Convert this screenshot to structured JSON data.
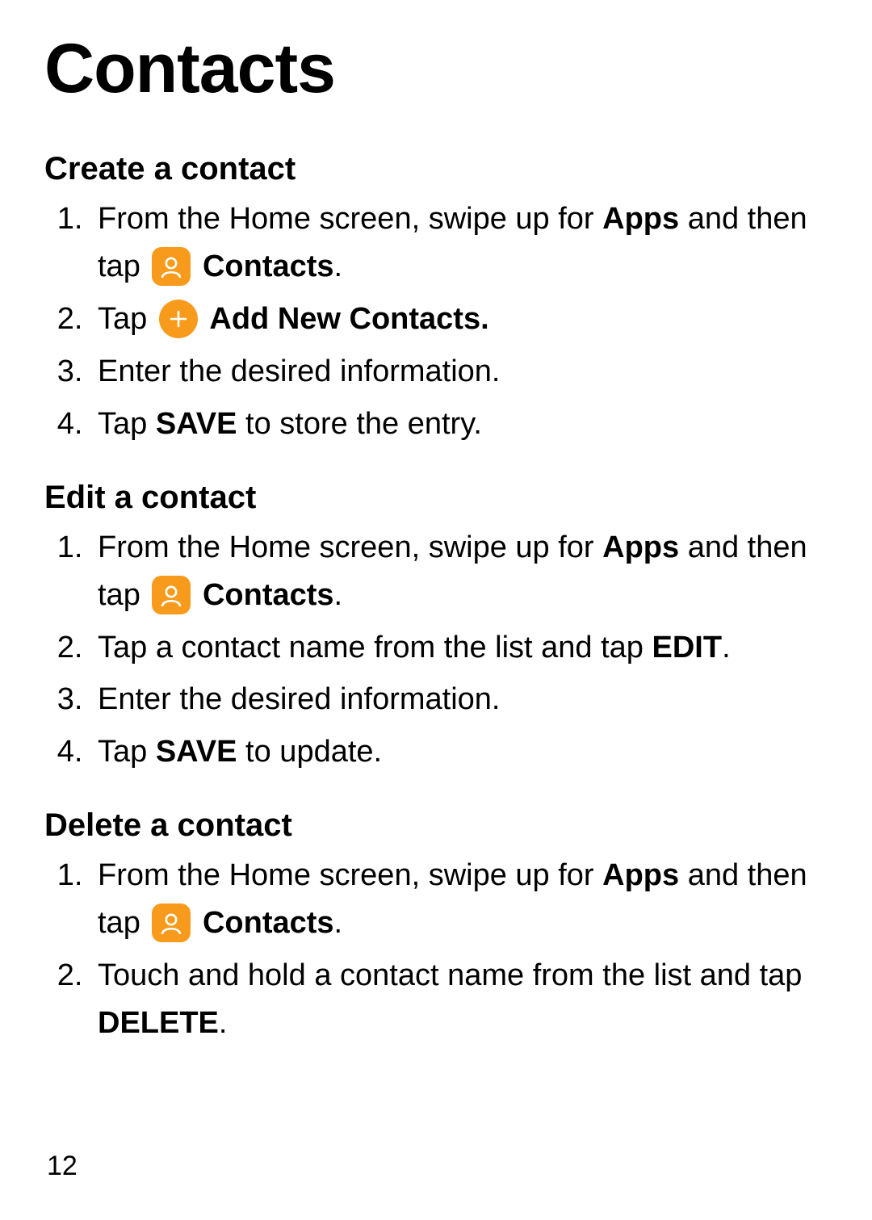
{
  "page": {
    "title": "Contacts",
    "number": "12"
  },
  "labels": {
    "apps": "Apps",
    "contacts": "Contacts",
    "addNewContacts": "Add New Contacts.",
    "save": "SAVE",
    "edit": "EDIT",
    "delete": "DELETE"
  },
  "text": {
    "fromHome": "From the Home screen, swipe up for ",
    "andThenTap": " and then tap ",
    "tap": "Tap ",
    "period": ".",
    "enterDesired": "Enter the desired information.",
    "toStore": " to store the entry.",
    "toUpdate": " to update.",
    "tapContactFromList": "Tap a contact name from the list and tap ",
    "touchHoldTap": "Touch and hold a contact name from the list and tap "
  },
  "sections": {
    "create": {
      "heading": "Create a contact"
    },
    "edit": {
      "heading": "Edit a contact"
    },
    "delete": {
      "heading": "Delete a contact"
    }
  }
}
